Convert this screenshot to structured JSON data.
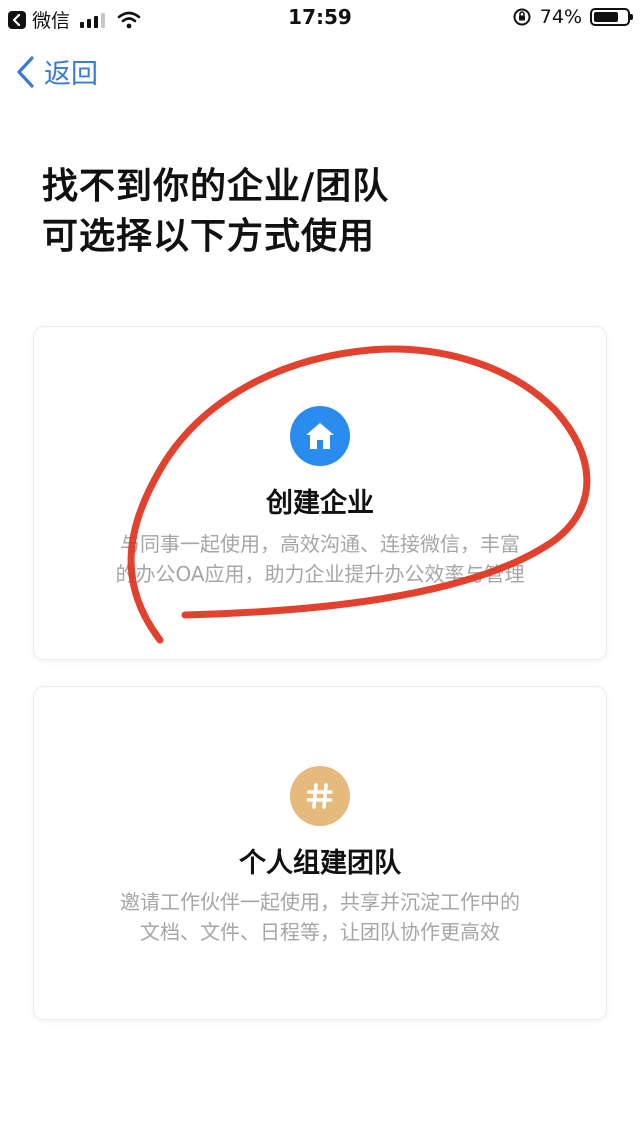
{
  "status_bar": {
    "carrier": "微信",
    "time": "17:59",
    "battery_percent": "74%",
    "battery_level": 0.74
  },
  "nav": {
    "back_label": "返回"
  },
  "heading": {
    "line1": "找不到你的企业/团队",
    "line2": "可选择以下方式使用"
  },
  "options": [
    {
      "icon": "home-icon",
      "icon_color": "#2b8cf0",
      "title": "创建企业",
      "desc_line1": "与同事一起使用，高效沟通、连接微信，丰富",
      "desc_line2": "的办公OA应用，助力企业提升办公效率与管理"
    },
    {
      "icon": "hashtag-icon",
      "icon_color": "#e6b97c",
      "title": "个人组建团队",
      "desc_line1": "邀请工作伙伴一起使用，共享并沉淀工作中的",
      "desc_line2": "文档、文件、日程等，让团队协作更高效"
    }
  ],
  "colors": {
    "link": "#3a7bd5",
    "annotation_stroke": "#e0311c",
    "desc_text": "#a6a6a6"
  }
}
